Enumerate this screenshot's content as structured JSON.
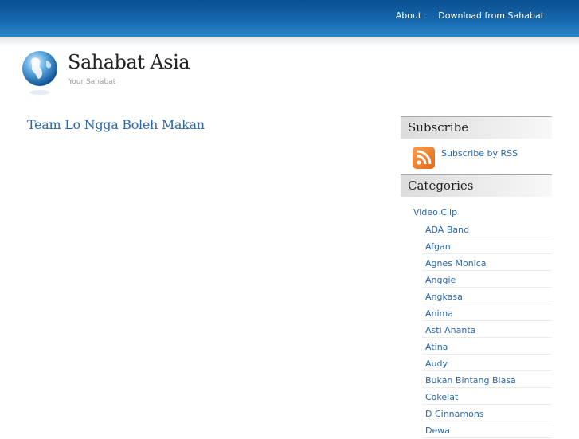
{
  "nav": {
    "items": [
      "About",
      "Download from Sahabat"
    ]
  },
  "header": {
    "title": "Sahabat Asia",
    "tagline": "Your Sahabat",
    "logo_icon": "globe-icon"
  },
  "post": {
    "title": "Team Lo Ngga Boleh Makan"
  },
  "sidebar": {
    "subscribe": {
      "heading": "Subscribe",
      "rss_label": "Subscribe by RSS",
      "rss_icon": "rss-icon"
    },
    "categories": {
      "heading": "Categories",
      "parent": "Video Clip",
      "items": [
        "ADA Band",
        "Afgan",
        "Agnes Monica",
        "Anggie",
        "Angkasa",
        "Anima",
        "Asti Ananta",
        "Atina",
        "Audy",
        "Bukan Bintang Biasa",
        "Cokelat",
        "D Cinnamons",
        "Dewa"
      ]
    }
  },
  "colors": {
    "header_blue": "#1668ad",
    "link_blue": "#2a67a8",
    "rss_orange": "#f08a2e"
  }
}
